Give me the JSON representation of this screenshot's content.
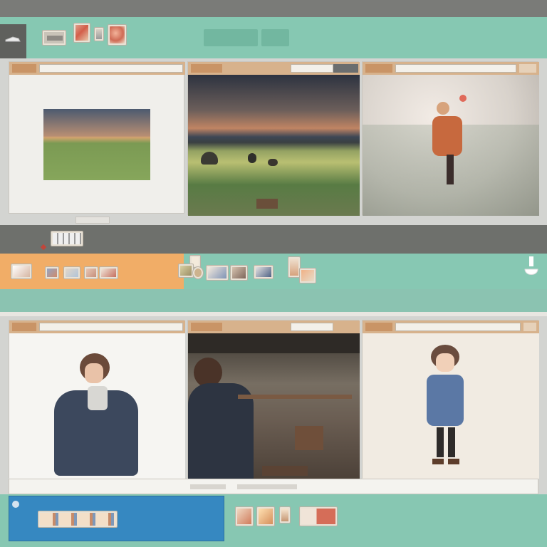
{
  "colors": {
    "teal": "#86c8b2",
    "orange": "#f1ad67",
    "blue": "#3688c1",
    "tab_tan": "#d7b28c",
    "dark_gray": "#6e706c"
  },
  "top_toolbar": {
    "left_button_icon": "shoe-icon",
    "thumbnails": [
      "thumbnail-icon",
      "thumbnail-icon",
      "thumbnail-icon",
      "thumbnail-icon"
    ],
    "pills": [
      "",
      ""
    ]
  },
  "top_windows": [
    {
      "name": "landscape-window",
      "url": ""
    },
    {
      "name": "field-scene-window",
      "url": ""
    },
    {
      "name": "fantasy-girl-window",
      "url": ""
    }
  ],
  "bottom_windows": [
    {
      "name": "boy-character-window",
      "url": ""
    },
    {
      "name": "room-scene-window",
      "url": ""
    },
    {
      "name": "girl-character-window",
      "url": ""
    }
  ],
  "mid_icons": {
    "cup_icon": "cup-icon"
  }
}
